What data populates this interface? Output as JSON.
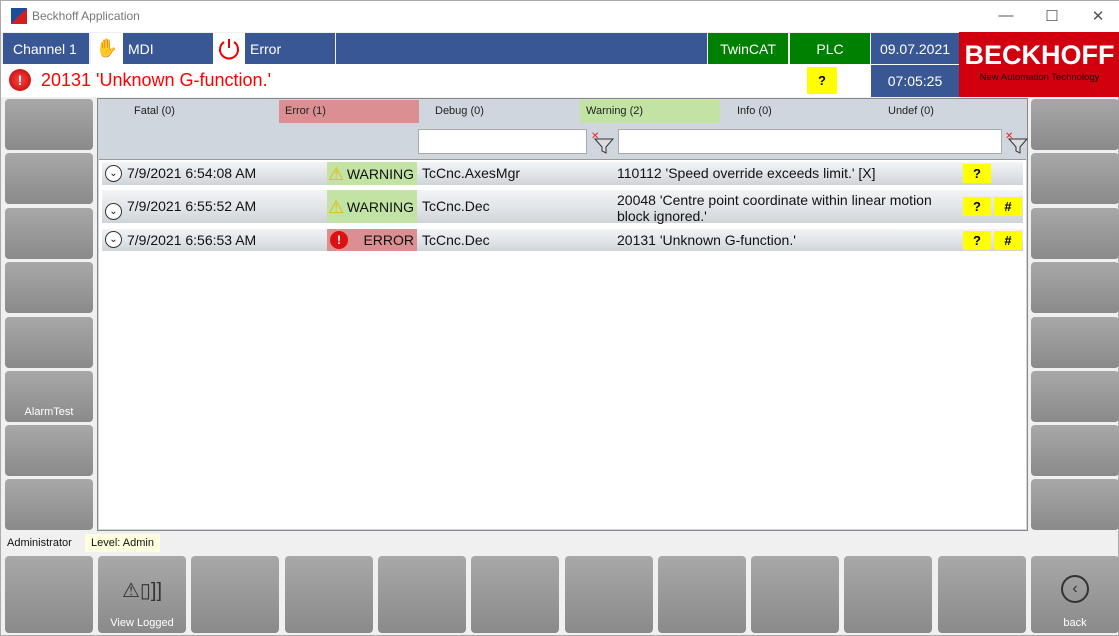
{
  "window": {
    "title": "Beckhoff Application",
    "minimize": "—",
    "maximize": "☐",
    "close": "✕"
  },
  "header": {
    "channel": "Channel  1",
    "mode": "MDI",
    "state": "Error",
    "twincat": "TwinCAT",
    "plc": "PLC",
    "date": "09.07.2021",
    "time": "07:05:25",
    "help": "?",
    "brand": "BECKHOFF",
    "brand_tagline": "New Automation Technology",
    "message": "20131 'Unknown G-function.'"
  },
  "colors": {
    "header_blue": "#3a5795",
    "ok_green": "#008000",
    "brand_red": "#d0000e",
    "error_text": "#ff0000",
    "warning_bg": "#c2e3a4",
    "error_bg": "#dc8f93",
    "help_yellow": "#ffff00"
  },
  "filters": {
    "tabs": [
      {
        "label": "Fatal (0)"
      },
      {
        "label": "Error (1)"
      },
      {
        "label": "Debug (0)"
      },
      {
        "label": "Warning (2)"
      },
      {
        "label": "Info (0)"
      },
      {
        "label": "Undef (0)"
      }
    ],
    "source_filter": "",
    "message_filter": ""
  },
  "alarms": [
    {
      "time": "7/9/2021 6:54:08 AM",
      "severity": "WARNING",
      "source": "TcCnc.AxesMgr",
      "message": "110112 'Speed override exceeds limit.' [X]",
      "help": "?",
      "hash": ""
    },
    {
      "time": "7/9/2021 6:55:52 AM",
      "severity": "WARNING",
      "source": "TcCnc.Dec",
      "message": "20048 'Centre point coordinate within linear motion block ignored.'",
      "help": "?",
      "hash": "#"
    },
    {
      "time": "7/9/2021 6:56:53 AM",
      "severity": "ERROR",
      "source": "TcCnc.Dec",
      "message": "20131 'Unknown G-function.'",
      "help": "?",
      "hash": "#"
    }
  ],
  "left_buttons": [
    "",
    "",
    "",
    "",
    "",
    "AlarmTest",
    "",
    ""
  ],
  "status": {
    "user": "Administrator",
    "level": "Level: Admin"
  },
  "bottom_buttons": [
    "",
    "View Logged",
    "",
    "",
    "",
    "",
    "",
    "",
    "",
    "",
    "",
    "back"
  ]
}
